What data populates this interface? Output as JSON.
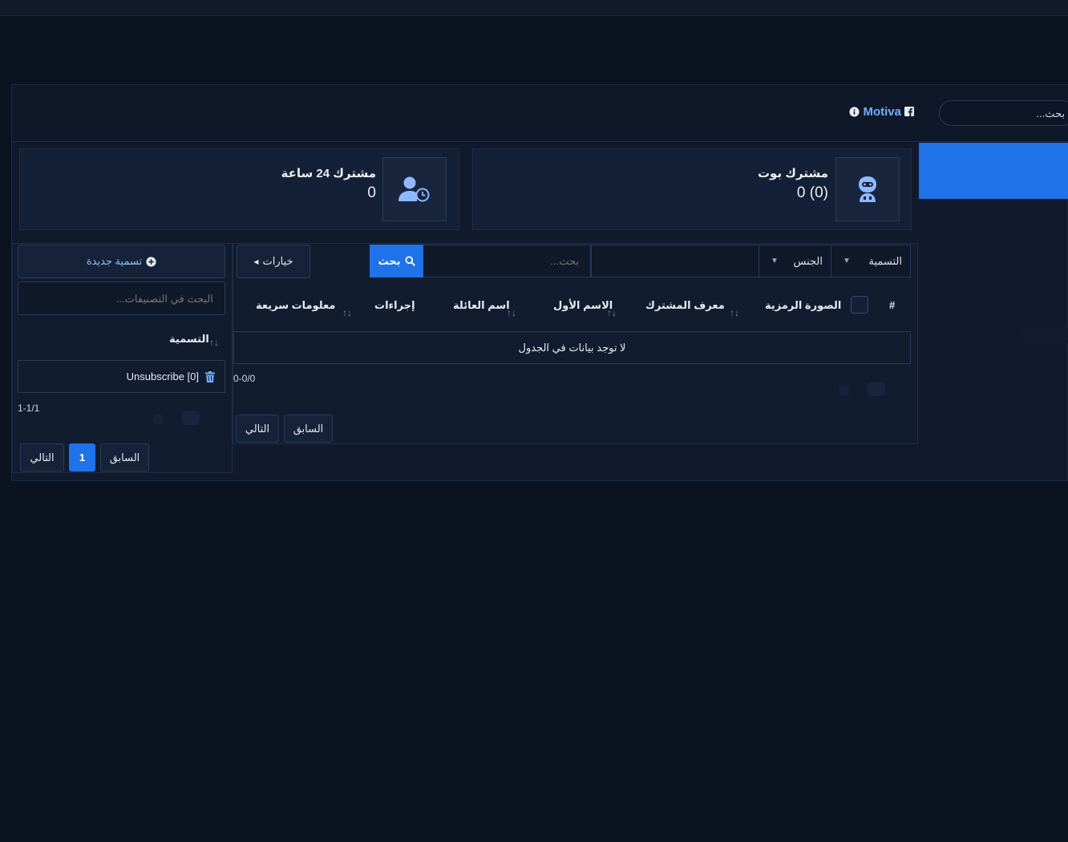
{
  "header": {
    "brand_name": "Motiva",
    "search_placeholder": "بحث..."
  },
  "cards": {
    "bot": {
      "title": "مشترك بوت",
      "value": "0 (0)"
    },
    "day": {
      "title": "مشترك 24 ساعة",
      "value": "0"
    }
  },
  "filters": {
    "label_select": "التسمية",
    "gender_select": "الجنس",
    "search_placeholder": "بحث...",
    "search_button": "بحث",
    "options_button": "خيارات"
  },
  "table": {
    "columns": {
      "hash": "#",
      "avatar": "الصورة الرمزية",
      "subscriber_id": "معرف المشترك",
      "first_name": "الاسم الأول",
      "last_name": "اسم العائلة",
      "actions": "إجراءات",
      "quick_info": "معلومات سريعة"
    },
    "empty_text": "لا توجد بيانات في الجدول",
    "info": "0-0/0",
    "prev": "السابق",
    "next": "التالي"
  },
  "labels": {
    "new_label": "تسمية جديدة",
    "search_placeholder": "البحث في التصنيفات...",
    "column": "التسمية",
    "items": [
      "Unsubscribe [0]"
    ],
    "info": "1-1/1",
    "prev": "السابق",
    "page": "1",
    "next": "التالي"
  },
  "colors": {
    "accent": "#1f72e8",
    "link": "#6fb0ff",
    "background": "#0b1220"
  }
}
